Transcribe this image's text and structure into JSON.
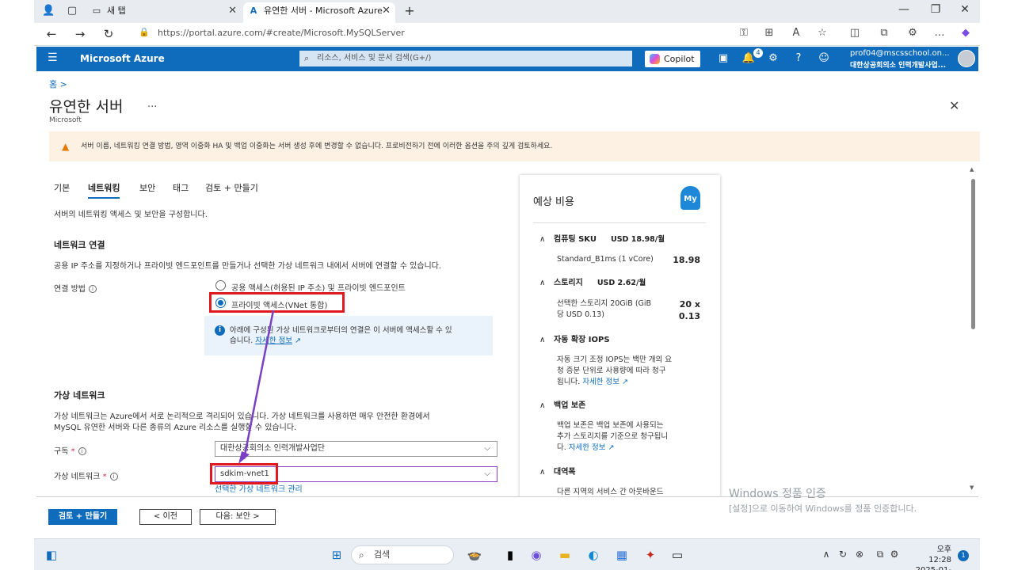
{
  "browser": {
    "tabs": [
      {
        "label": "새 탭"
      },
      {
        "label": "유연한 서버 - Microsoft Azure"
      }
    ],
    "url": "https://portal.azure.com/#create/Microsoft.MySQLServer"
  },
  "azure_header": {
    "brand": "Microsoft Azure",
    "search_placeholder": "리소스, 서비스 및 문서 검색(G+/)",
    "copilot": "Copilot",
    "notification_count": "4",
    "user_email": "prof04@mscsschool.on...",
    "user_org": "대한상공회의소 인력개발사업..."
  },
  "page": {
    "breadcrumb": "홈 >",
    "title": "유연한 서버",
    "more": "...",
    "subtitle": "Microsoft",
    "warning": "서버 이름, 네트워킹 연결 방법, 영역 이중화 HA 및 백업 이중화는 서버 생성 후에 변경할 수 없습니다. 프로비전하기 전에 이러한 옵션을 주의 깊게 검토하세요.",
    "tabs": [
      {
        "label": "기본"
      },
      {
        "label": "네트워킹"
      },
      {
        "label": "보안"
      },
      {
        "label": "태그"
      },
      {
        "label": "검토 + 만들기"
      }
    ],
    "tab_desc": "서버의 네트워킹 액세스 및 보안을 구성합니다.",
    "network_heading": "네트워크 연결",
    "network_desc": "공용 IP 주소를 지정하거나 프라이빗 엔드포인트를 만들거나 선택한 가상 네트워크 내에서 서버에 연결할 수 있습니다.",
    "conn_method_label": "연결 방법",
    "radio_public": "공용 액세스(허용된 IP 주소) 및 프라이빗 엔드포인트",
    "radio_private": "프라이빗 액세스(VNet 통합)",
    "info_line1": "아래에 구성된 가상 네트워크로부터의 연결은 이 서버에 액세스할 수 있",
    "info_line2": "습니다.",
    "info_link": "자세한 정보",
    "vnet_heading": "가상 네트워크",
    "vnet_desc1": "가상 네트워크는 Azure에서 서로 논리적으로 격리되어 있습니다. 가상 네트워크를 사용하면 매우 안전한 환경에서",
    "vnet_desc2": "MySQL 유연한 서버와 다른 종류의 Azure 리소스를 실행할 수 있습니다.",
    "subscription_label": "구독",
    "subscription_value": "대한상공회의소 인력개발사업단",
    "vnet_label": "가상 네트워크",
    "vnet_value": "sdkim-vnet1",
    "vnet_manage_link": "선택한 가상 네트워크 관리"
  },
  "cost": {
    "title": "예상 비용",
    "sections": [
      {
        "name": "컴퓨팅 SKU",
        "summary": "USD 18.98/월"
      },
      {
        "name": "스토리지",
        "summary": "USD 2.62/월"
      },
      {
        "name": "자동 확장 IOPS",
        "summary": ""
      },
      {
        "name": "백업 보존",
        "summary": ""
      },
      {
        "name": "대역폭",
        "summary": ""
      }
    ],
    "compute_detail": "Standard_B1ms (1 vCore)",
    "compute_value": "18.98",
    "storage_detail1": "선택한 스토리지 20GiB (GiB",
    "storage_detail2": "당 USD 0.13)",
    "storage_value1": "20 x",
    "storage_value2": "0.13",
    "iops_line1": "자동 크기 조정 IOPS는 백만 개의 요",
    "iops_line2": "청 증분 단위로 사용량에 따라 청구",
    "iops_line3": "됩니다.",
    "iops_link": "자세한 정보",
    "backup_line1": "백업 보존은 백업 보존에 사용되는",
    "backup_line2": "추가 스토리지를 기준으로 청구됩니",
    "backup_line3": "다.",
    "backup_link": "자세한 정보",
    "bandwidth_line1": "다른 지역의 서비스 간 아웃바운드"
  },
  "footer": {
    "review_create": "검토 + 만들기",
    "prev": "< 이전",
    "next": "다음: 보안 >"
  },
  "watermark": {
    "line1": "Windows 정품 인증",
    "line2": "[설정]으로 이동하여 Windows를 정품 인증합니다."
  },
  "taskbar": {
    "search": "검색",
    "time": "오후 12:28",
    "date": "2025-01-09",
    "notification_count": "1"
  },
  "colors": {
    "azure_blue": "#0f6cbd",
    "highlight_red": "#e0191e",
    "arrow_purple": "#7b3fc4"
  }
}
